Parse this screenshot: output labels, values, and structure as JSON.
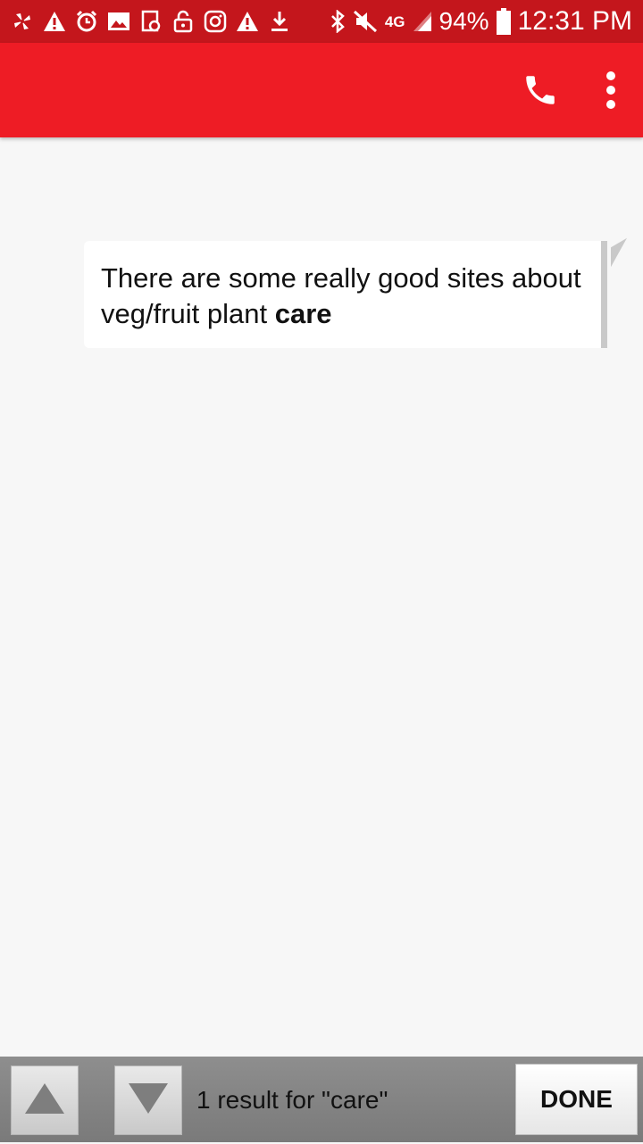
{
  "status_bar": {
    "left_icons": [
      "pinwheel-icon",
      "alert-icon",
      "alarm-icon",
      "image-icon",
      "screenshot-icon",
      "lock-icon",
      "instagram-icon",
      "alert-icon",
      "download-icon"
    ],
    "right_icons": [
      "bluetooth-icon",
      "mute-icon",
      "lte-icon",
      "signal-icon"
    ],
    "network": "4G",
    "battery": "94%",
    "time": "12:31 PM",
    "bar_color": "#c4161c"
  },
  "app_bar": {
    "color": "#ee1c25",
    "call_icon": "phone-icon",
    "more_icon": "more-vert-icon"
  },
  "message": {
    "text_before": "There are some really good sites about veg/fruit plant ",
    "highlight": "care"
  },
  "search_bar": {
    "result_text": "1 result for \"care\"",
    "done_label": "DONE",
    "prev_icon": "arrow-up-icon",
    "next_icon": "arrow-down-icon"
  }
}
